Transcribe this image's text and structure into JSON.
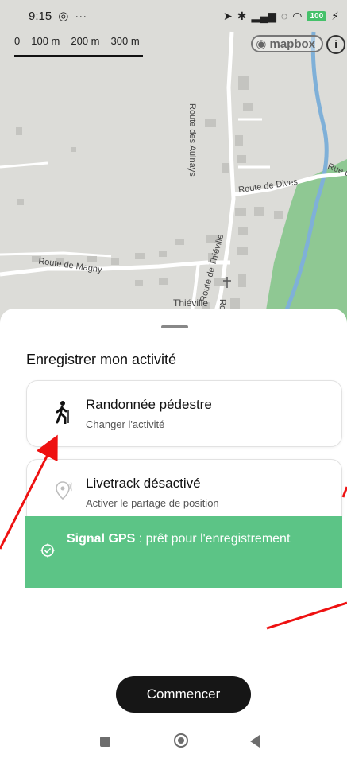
{
  "status_bar": {
    "time": "9:15",
    "left_icons": [
      "instagram-icon",
      "more-notifications-icon"
    ],
    "right_icons": [
      "location-arrow-icon",
      "bluetooth-icon",
      "signal-icon",
      "wifi-calling-icon",
      "wifi-icon",
      "battery-icon"
    ],
    "battery": "100"
  },
  "map": {
    "scale_labels": [
      "0",
      "100 m",
      "200 m",
      "300 m"
    ],
    "attribution": "mapbox",
    "road_labels": {
      "aulnays": "Route des Aulnays",
      "dives": "Route de Dives",
      "rue": "Rue d",
      "magny": "Route de Magny",
      "thieville_road": "Route de Thiéville",
      "thieville": "Thiéville",
      "other": "Rou"
    }
  },
  "sheet": {
    "title": "Enregistrer mon activité",
    "activity": {
      "label": "Randonnée pédestre",
      "sub": "Changer l'activité",
      "icon": "hiker-icon"
    },
    "livetrack": {
      "label": "Livetrack désactivé",
      "sub": "Activer le partage de position",
      "icon": "location-pin-icon"
    },
    "gps": {
      "bold": "Signal GPS",
      "rest": " : prêt pour l'enregistrement",
      "icon": "gps-check-icon",
      "color": "#5cc486"
    },
    "start_label": "Commencer"
  },
  "nav": [
    "recents-square-icon",
    "home-circle-icon",
    "back-triangle-icon"
  ],
  "colors": {
    "arrow": "#ee1111",
    "button": "#161616",
    "river": "#7fb0d8",
    "green": "#8fc893"
  }
}
